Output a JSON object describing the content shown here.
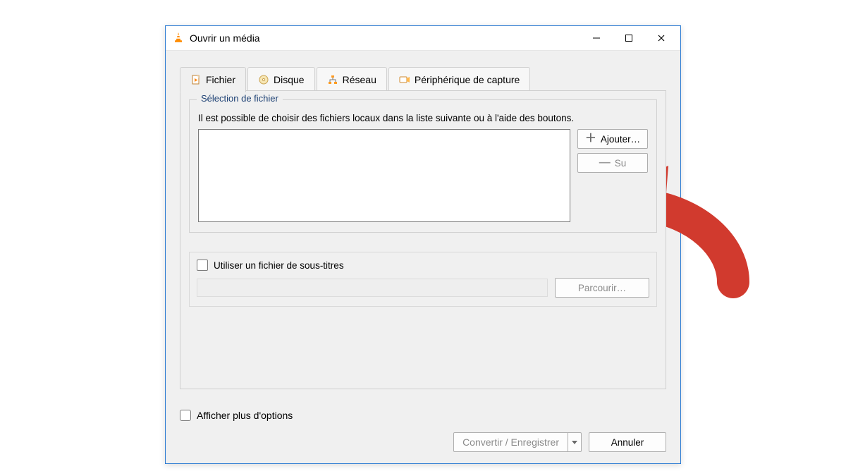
{
  "window": {
    "title": "Ouvrir un média"
  },
  "tabs": {
    "file": {
      "label": "Fichier"
    },
    "disc": {
      "label": "Disque"
    },
    "network": {
      "label": "Réseau"
    },
    "capture": {
      "label": "Périphérique de capture"
    }
  },
  "fileSelection": {
    "legend": "Sélection de fichier",
    "help": "Il est possible de choisir des fichiers locaux dans la liste suivante ou à l'aide des boutons.",
    "add": "Ajouter…",
    "remove": "Su"
  },
  "subtitles": {
    "useLabel": "Utiliser un fichier de sous-titres",
    "browse": "Parcourir…"
  },
  "footer": {
    "more": "Afficher plus d'options",
    "convert": "Convertir / Enregistrer",
    "cancel": "Annuler"
  }
}
